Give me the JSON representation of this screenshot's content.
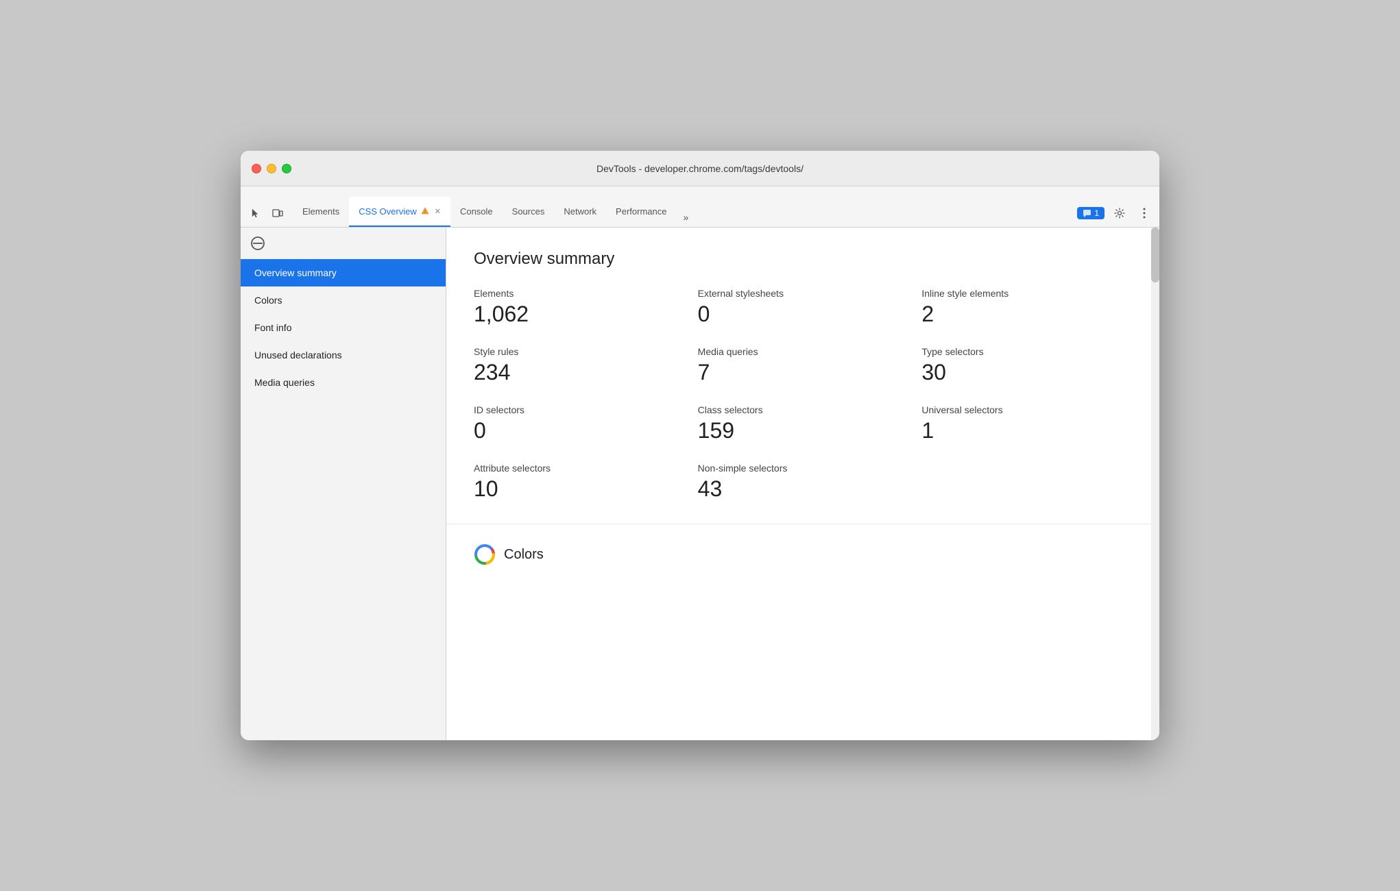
{
  "window": {
    "title": "DevTools - developer.chrome.com/tags/devtools/"
  },
  "tabs": [
    {
      "id": "elements",
      "label": "Elements",
      "active": false
    },
    {
      "id": "css-overview",
      "label": "CSS Overview",
      "active": true,
      "hasIcon": true,
      "closable": true
    },
    {
      "id": "console",
      "label": "Console",
      "active": false
    },
    {
      "id": "sources",
      "label": "Sources",
      "active": false
    },
    {
      "id": "network",
      "label": "Network",
      "active": false
    },
    {
      "id": "performance",
      "label": "Performance",
      "active": false
    }
  ],
  "more_tabs_label": "»",
  "chat_count": "1",
  "sidebar": {
    "items": [
      {
        "id": "overview-summary",
        "label": "Overview summary",
        "active": true
      },
      {
        "id": "colors",
        "label": "Colors",
        "active": false
      },
      {
        "id": "font-info",
        "label": "Font info",
        "active": false
      },
      {
        "id": "unused-declarations",
        "label": "Unused declarations",
        "active": false
      },
      {
        "id": "media-queries",
        "label": "Media queries",
        "active": false
      }
    ]
  },
  "main": {
    "overview": {
      "title": "Overview summary",
      "stats": [
        {
          "label": "Elements",
          "value": "1,062"
        },
        {
          "label": "External stylesheets",
          "value": "0"
        },
        {
          "label": "Inline style elements",
          "value": "2"
        },
        {
          "label": "Style rules",
          "value": "234"
        },
        {
          "label": "Media queries",
          "value": "7"
        },
        {
          "label": "Type selectors",
          "value": "30"
        },
        {
          "label": "ID selectors",
          "value": "0"
        },
        {
          "label": "Class selectors",
          "value": "159"
        },
        {
          "label": "Universal selectors",
          "value": "1"
        },
        {
          "label": "Attribute selectors",
          "value": "10"
        },
        {
          "label": "Non-simple selectors",
          "value": "43"
        }
      ]
    },
    "colors_section": {
      "title": "Colors"
    }
  },
  "icons": {
    "cursor": "⬚",
    "device": "⬜",
    "ban": "⊘",
    "gear": "⚙",
    "dots": "⋮",
    "chat": "💬"
  }
}
